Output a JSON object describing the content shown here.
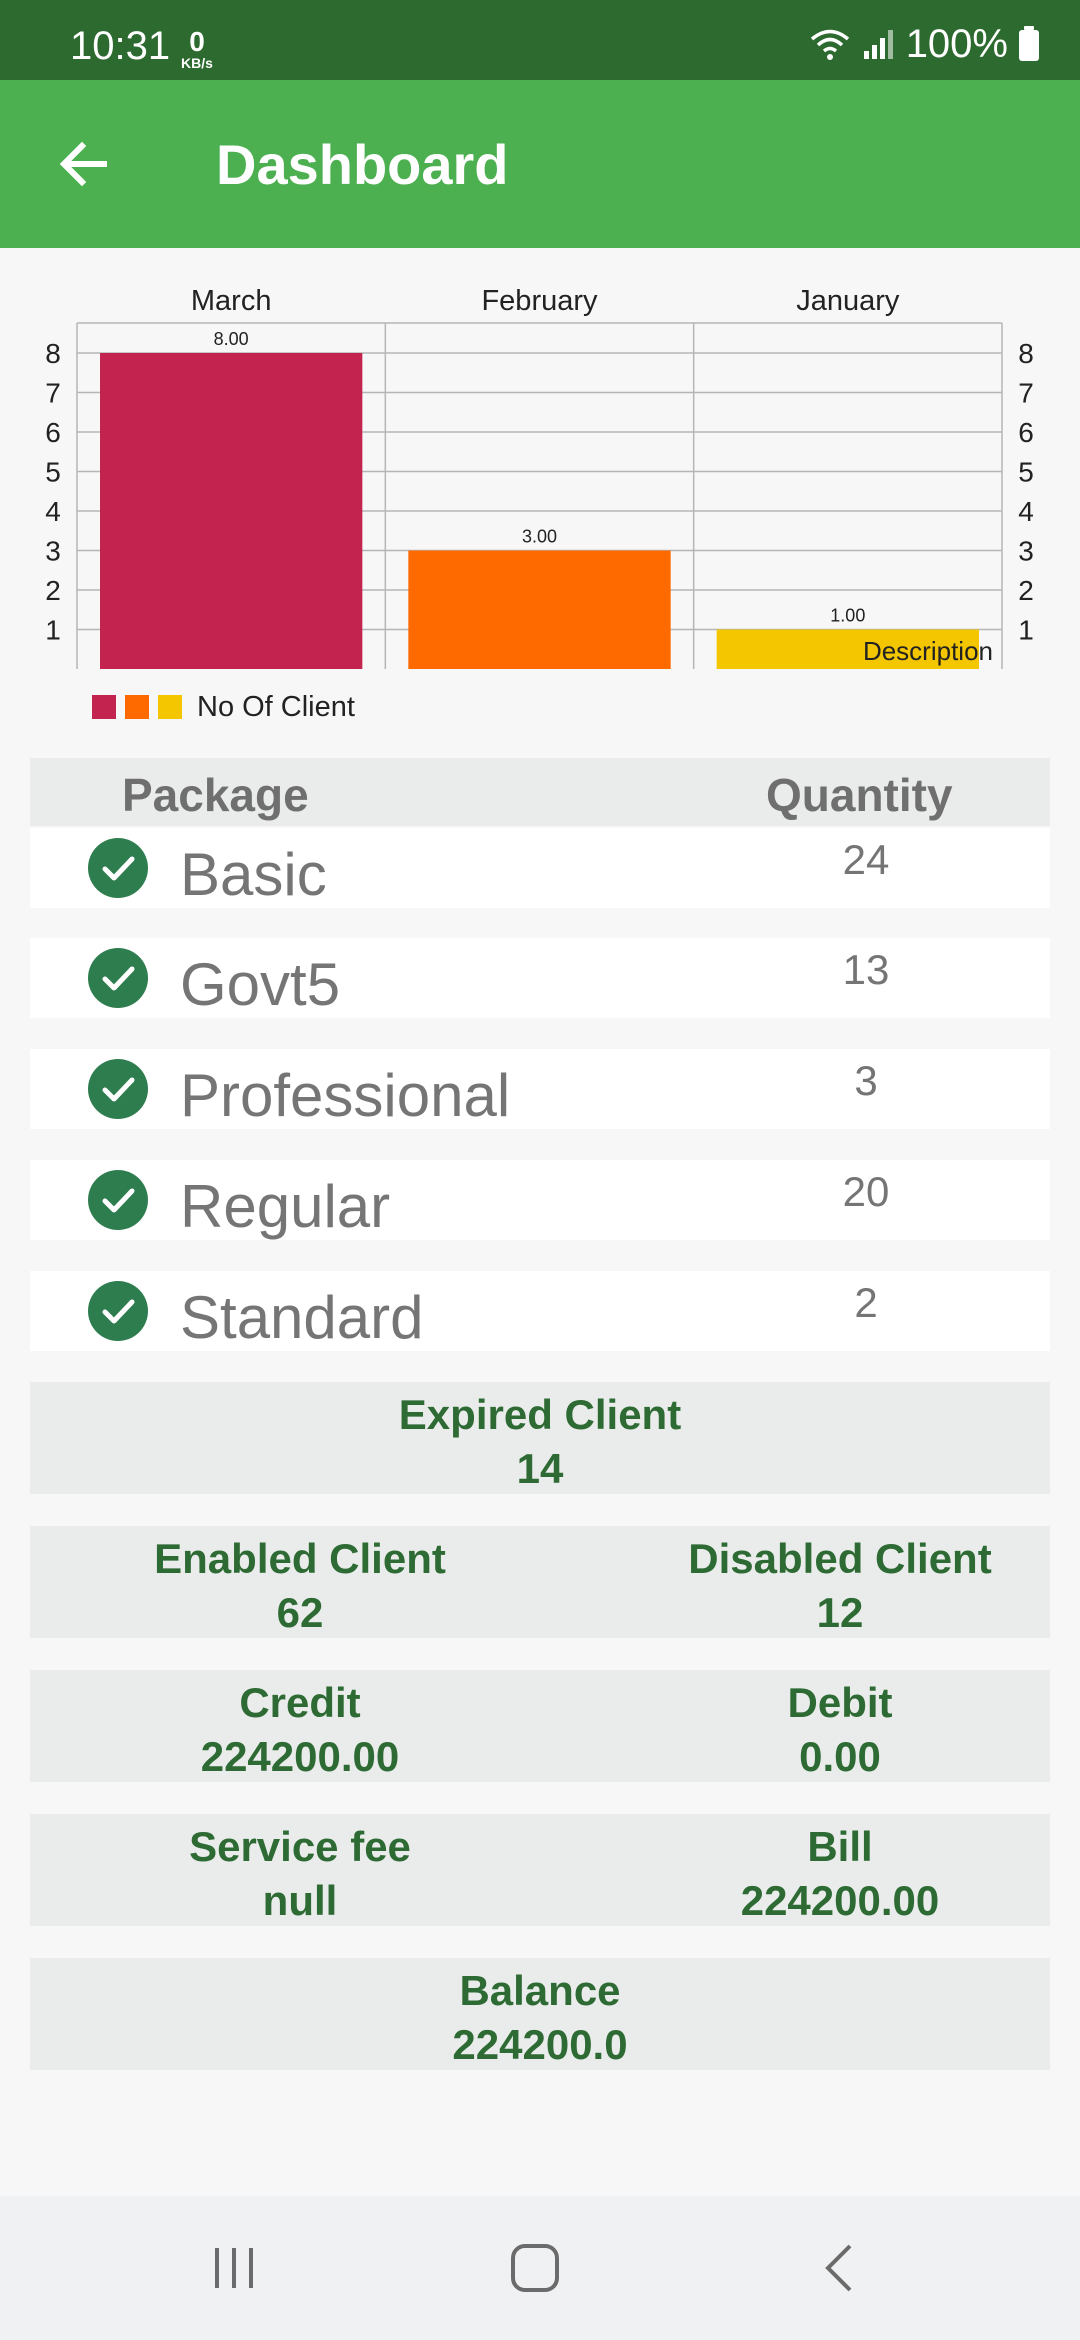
{
  "status_bar": {
    "time": "10:31",
    "speed_value": "0",
    "speed_unit": "KB/s",
    "battery": "100%",
    "icons": [
      "wifi-icon",
      "signal-icon",
      "battery-icon"
    ]
  },
  "app_bar": {
    "title": "Dashboard",
    "back_icon": "arrow-back-icon"
  },
  "chart_data": {
    "type": "bar",
    "categories": [
      "March",
      "February",
      "January"
    ],
    "values": [
      8,
      3,
      1
    ],
    "value_labels": [
      "8.00",
      "3.00",
      "1.00"
    ],
    "colors": [
      "#c2234f",
      "#ff6a00",
      "#f3c600"
    ],
    "series": [
      {
        "name": "No Of Client",
        "values": [
          8,
          3,
          1
        ]
      }
    ],
    "ylim": [
      0,
      8
    ],
    "y_ticks": [
      "1",
      "2",
      "3",
      "4",
      "5",
      "6",
      "7",
      "8"
    ],
    "grid": true,
    "legend": "bottom-left",
    "description": "Description"
  },
  "packages": {
    "header_package": "Package",
    "header_quantity": "Quantity",
    "rows": [
      {
        "name": "Basic",
        "quantity": "24"
      },
      {
        "name": "Govt5",
        "quantity": "13"
      },
      {
        "name": "Professional",
        "quantity": "3"
      },
      {
        "name": "Regular",
        "quantity": "20"
      },
      {
        "name": "Standard",
        "quantity": "2"
      }
    ]
  },
  "stats": {
    "expired_label": "Expired Client",
    "expired_value": "14",
    "enabled_label": "Enabled Client",
    "enabled_value": "62",
    "disabled_label": "Disabled Client",
    "disabled_value": "12",
    "credit_label": "Credit",
    "credit_value": "224200.00",
    "debit_label": "Debit",
    "debit_value": "0.00",
    "service_fee_label": "Service fee",
    "service_fee_value": "null",
    "bill_label": "Bill",
    "bill_value": "224200.00",
    "balance_label": "Balance",
    "balance_value": "224200.0"
  },
  "colors": {
    "status_bar": "#2d6a2f",
    "app_bar": "#4caf50",
    "accent_text": "#2e6b34",
    "check": "#2e7d4f"
  }
}
